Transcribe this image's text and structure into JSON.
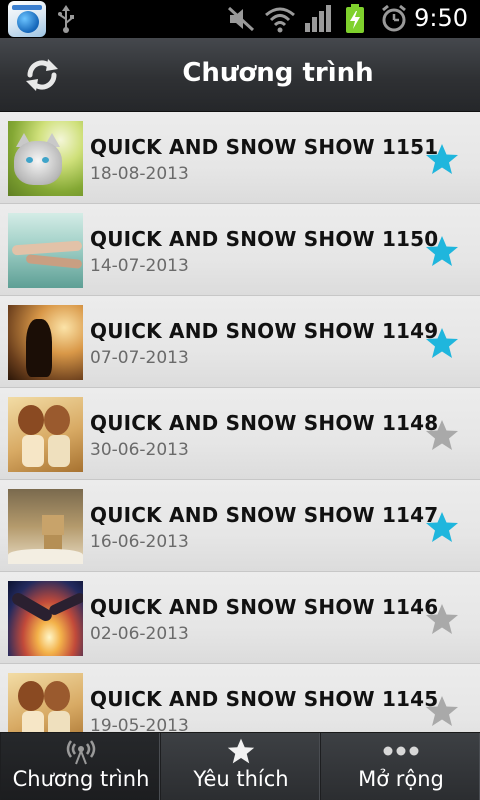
{
  "status_bar": {
    "time": "9:50",
    "icons": [
      "app-icon",
      "usb-icon",
      "mute-icon",
      "wifi-icon",
      "signal-icon",
      "battery-charging-icon",
      "alarm-icon"
    ]
  },
  "header": {
    "title": "Chương trình",
    "refresh_icon": "refresh-icon"
  },
  "list": {
    "items": [
      {
        "title": "QUICK AND SNOW SHOW 1151",
        "date": "18-08-2013",
        "favorited": true,
        "thumbnail": "kitten"
      },
      {
        "title": "QUICK AND SNOW SHOW 1150",
        "date": "14-07-2013",
        "favorited": true,
        "thumbnail": "hands-rain"
      },
      {
        "title": "QUICK AND SNOW SHOW 1149",
        "date": "07-07-2013",
        "favorited": true,
        "thumbnail": "girl-sunset"
      },
      {
        "title": "QUICK AND SNOW SHOW 1148",
        "date": "30-06-2013",
        "favorited": false,
        "thumbnail": "twin-dolls"
      },
      {
        "title": "QUICK AND SNOW SHOW 1147",
        "date": "16-06-2013",
        "favorited": true,
        "thumbnail": "danbo-snow"
      },
      {
        "title": "QUICK AND SNOW SHOW 1146",
        "date": "02-06-2013",
        "favorited": false,
        "thumbnail": "hands-light"
      },
      {
        "title": "QUICK AND SNOW SHOW 1145",
        "date": "19-05-2013",
        "favorited": false,
        "thumbnail": "twin-dolls"
      }
    ]
  },
  "tab_bar": {
    "tabs": [
      {
        "label": "Chương trình",
        "icon": "broadcast-icon",
        "active": true
      },
      {
        "label": "Yêu thích",
        "icon": "star-icon",
        "active": false
      },
      {
        "label": "Mở rộng",
        "icon": "more-dots-icon",
        "active": false
      }
    ]
  },
  "colors": {
    "star_active": "#1fb6dd",
    "star_inactive": "#a9a9a9",
    "battery": "#7fd12d"
  }
}
